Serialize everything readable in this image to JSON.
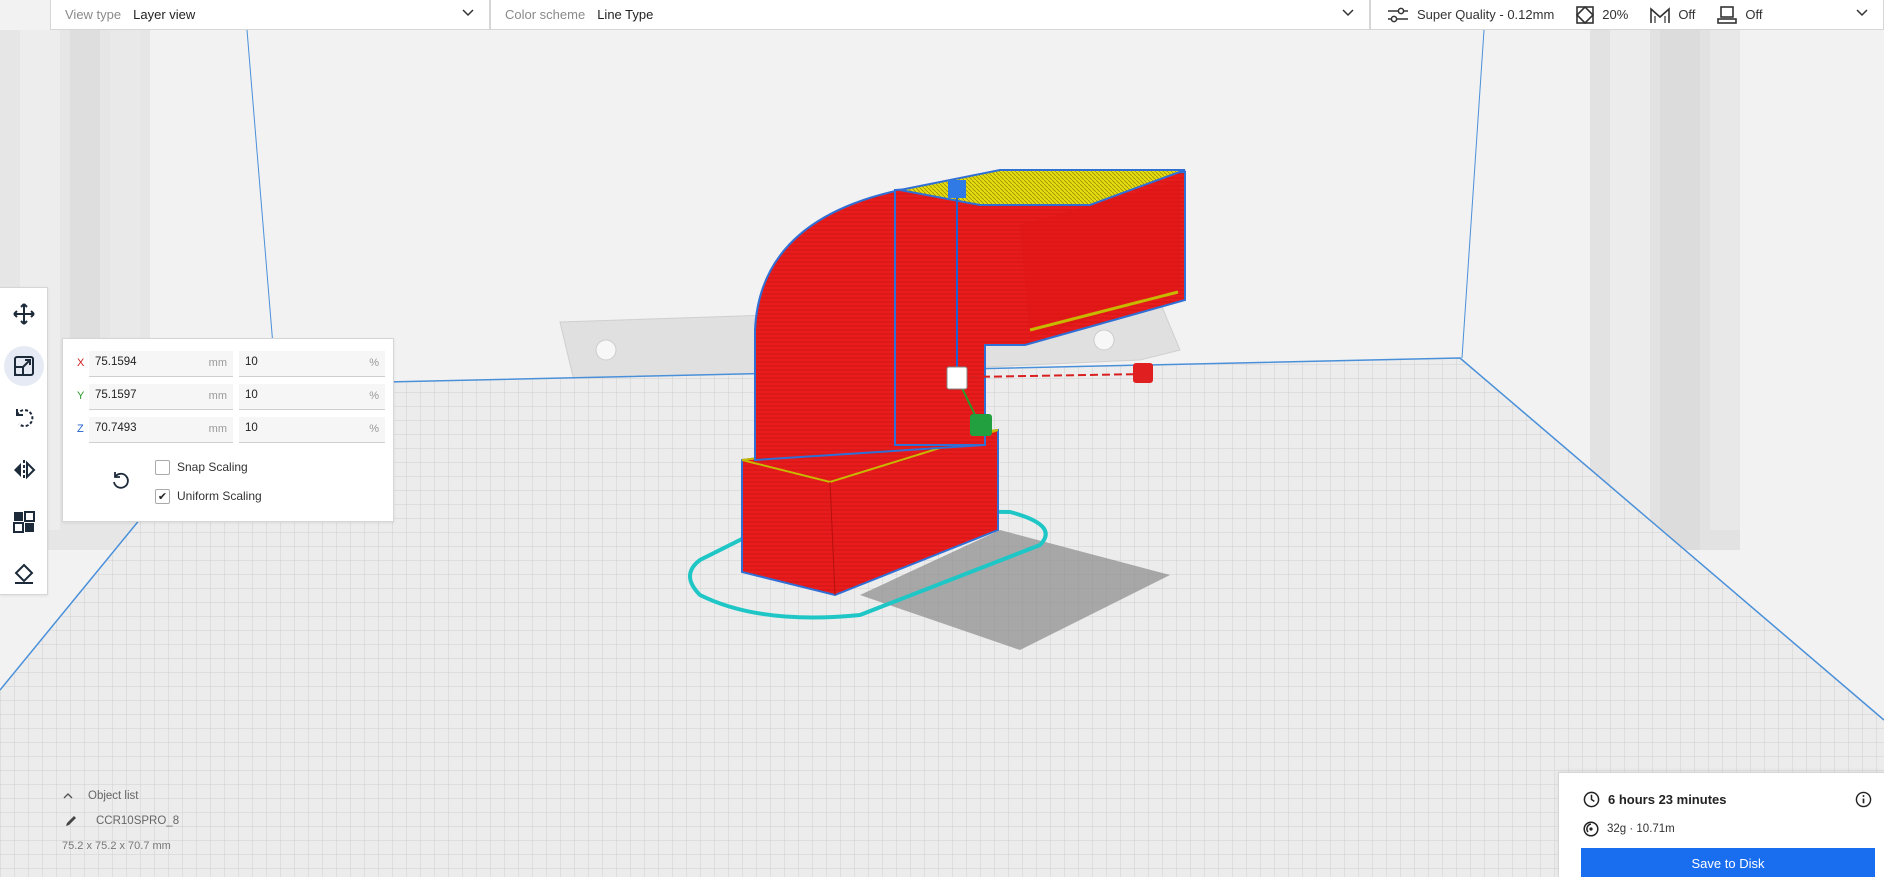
{
  "topbar": {
    "view_type_label": "View type",
    "view_type_value": "Layer view",
    "color_scheme_label": "Color scheme",
    "color_scheme_value": "Line Type",
    "quality": "Super Quality - 0.12mm",
    "infill": "20%",
    "support": "Off",
    "adhesion": "Off"
  },
  "left_toolbar": {
    "tools": [
      "move-icon",
      "scale-icon",
      "rotate-icon",
      "mirror-icon",
      "per-model-settings-icon",
      "support-blocker-icon"
    ],
    "active_tool": "scale"
  },
  "scale_panel": {
    "x": {
      "letter": "X",
      "mm": "75.1594",
      "pct": "10",
      "color": "#d02020"
    },
    "y": {
      "letter": "Y",
      "mm": "75.1597",
      "pct": "10",
      "color": "#2a9a2a"
    },
    "z": {
      "letter": "Z",
      "mm": "70.7493",
      "pct": "10",
      "color": "#2060d0"
    },
    "unit_mm": "mm",
    "unit_pct": "%",
    "snap_scaling_label": "Snap Scaling",
    "snap_scaling_checked": false,
    "uniform_scaling_label": "Uniform Scaling",
    "uniform_scaling_checked": true
  },
  "object_list": {
    "header": "Object list",
    "item_name": "CCR10SPRO_8",
    "dimensions": "75.2 x 75.2 x 70.7 mm"
  },
  "print_panel": {
    "time": "6 hours 23 minutes",
    "material": "32g · 10.71m",
    "save_label": "Save to Disk"
  },
  "colors": {
    "accent": "#196ef0",
    "model_red": "#e81c1c",
    "model_yellow": "#e8e000",
    "outline_cyan": "#1fc6c6"
  }
}
